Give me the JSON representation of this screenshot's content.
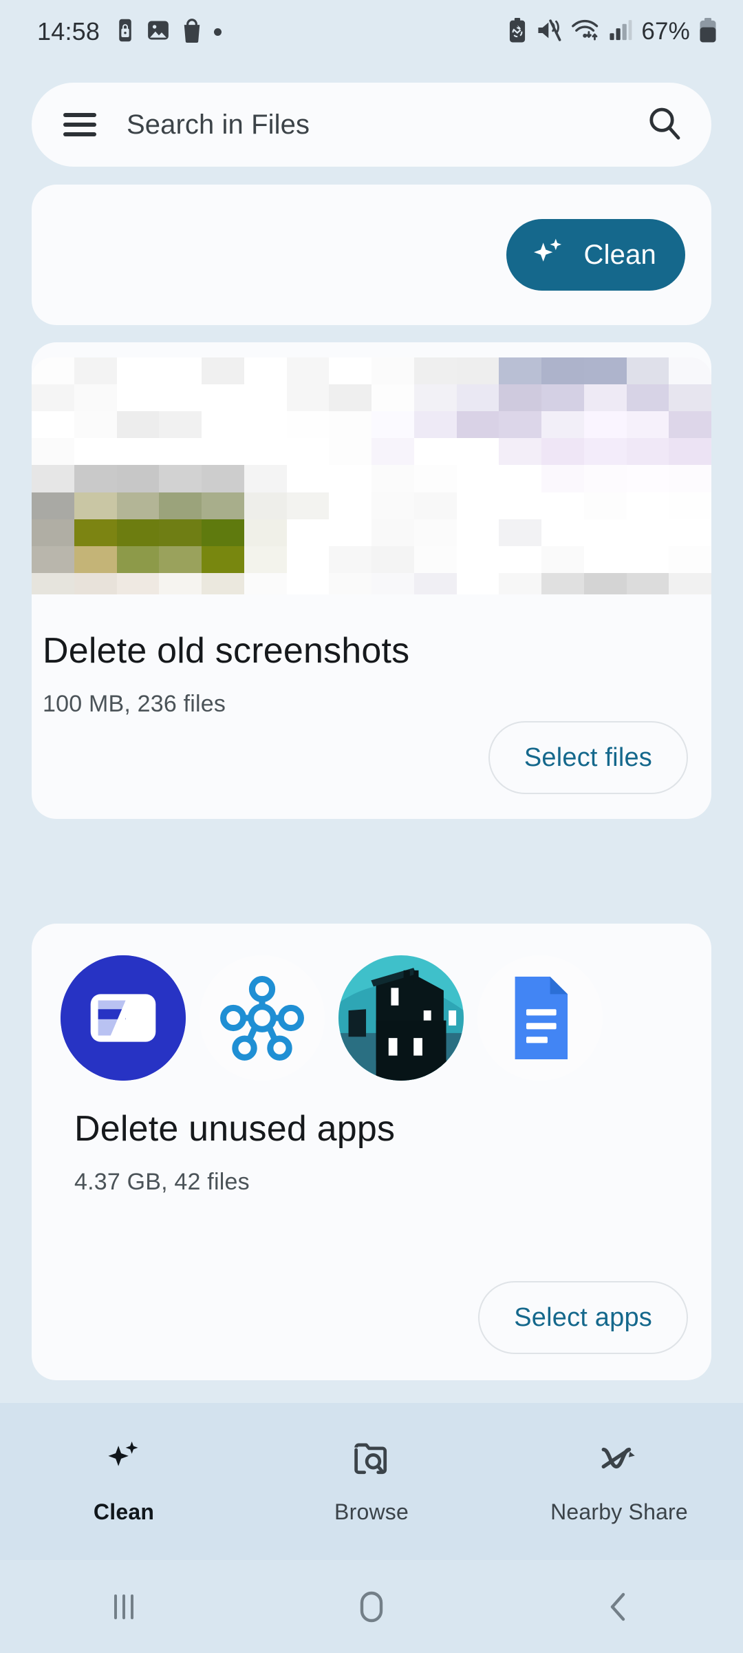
{
  "status_bar": {
    "time": "14:58",
    "left_icons": [
      "phone-lock-icon",
      "image-icon",
      "shopping-bag-icon",
      "dot-indicator"
    ],
    "right_icons": [
      "battery-saver-icon",
      "mute-vibrate-icon",
      "wifi-icon",
      "signal-icon"
    ],
    "battery_percent": "67%",
    "battery_icon": "battery-icon"
  },
  "search": {
    "menu_icon": "hamburger-menu-icon",
    "placeholder": "Search in Files",
    "search_icon": "search-icon"
  },
  "clean_card": {
    "button_label": "Clean",
    "button_icon": "sparkle-icon",
    "button_color": "#15688c"
  },
  "cards": [
    {
      "id": "screenshots",
      "thumbnail": "blurred-screenshot-mosaic",
      "title": "Delete old screenshots",
      "subtitle": "100 MB, 236 files",
      "action_label": "Select files"
    },
    {
      "id": "apps",
      "title": "Delete unused apps",
      "subtitle": "4.37 GB, 42 files",
      "action_label": "Select apps",
      "app_icons": [
        {
          "name": "samsung-wallet-icon",
          "bg": "#2733c4"
        },
        {
          "name": "smartthings-icon",
          "bg": "#ffffff"
        },
        {
          "name": "game-app-icon",
          "bg": "#3fbfc9"
        },
        {
          "name": "google-docs-icon",
          "bg": "#ffffff"
        }
      ]
    }
  ],
  "bottom_nav": {
    "items": [
      {
        "label": "Clean",
        "icon": "sparkle-icon",
        "active": true
      },
      {
        "label": "Browse",
        "icon": "folder-search-icon",
        "active": false
      },
      {
        "label": "Nearby Share",
        "icon": "nearby-share-icon",
        "active": false
      }
    ]
  },
  "system_nav": {
    "recents": "recents-icon",
    "home": "home-icon",
    "back": "back-icon"
  },
  "theme": {
    "page_bg": "#dfeaf2",
    "card_bg": "#fafbfd",
    "accent": "#15688c",
    "nav_bg": "#d3e2ee"
  }
}
